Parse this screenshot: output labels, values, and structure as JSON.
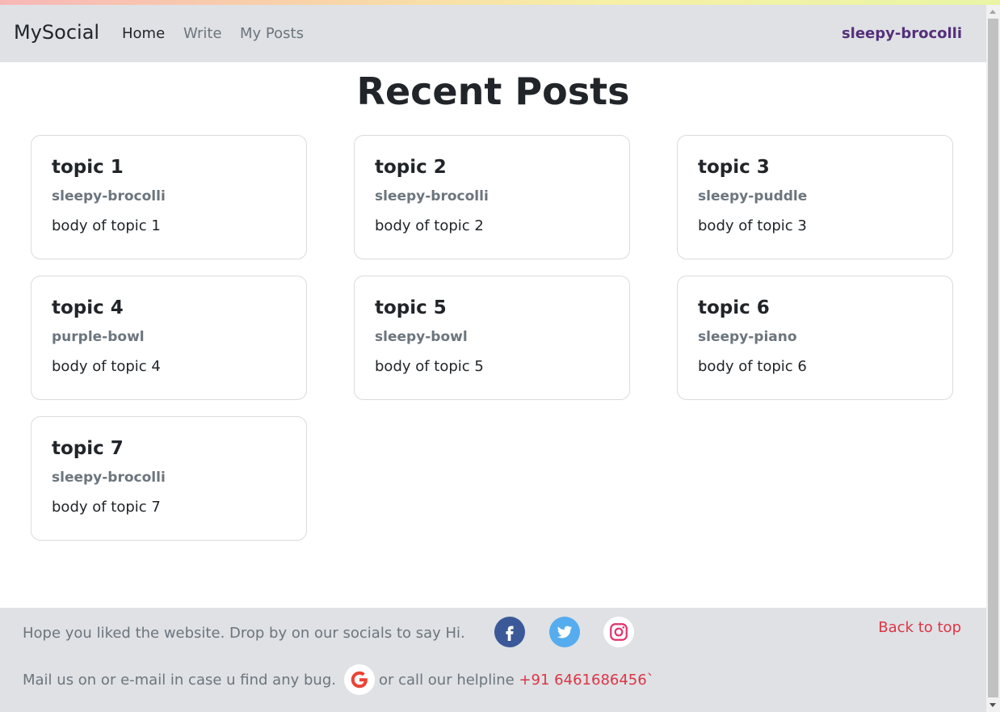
{
  "navbar": {
    "brand": "MySocial",
    "links": [
      "Home",
      "Write",
      "My Posts"
    ],
    "user": "sleepy-brocolli"
  },
  "page": {
    "title": "Recent Posts"
  },
  "posts": [
    {
      "title": "topic 1",
      "author": "sleepy-brocolli",
      "body": "body of topic 1"
    },
    {
      "title": "topic 2",
      "author": "sleepy-brocolli",
      "body": "body of topic 2"
    },
    {
      "title": "topic 3",
      "author": "sleepy-puddle",
      "body": "body of topic 3"
    },
    {
      "title": "topic 4",
      "author": "purple-bowl",
      "body": "body of topic 4"
    },
    {
      "title": "topic 5",
      "author": "sleepy-bowl",
      "body": "body of topic 5"
    },
    {
      "title": "topic 6",
      "author": "sleepy-piano",
      "body": "body of topic 6"
    },
    {
      "title": "topic 7",
      "author": "sleepy-brocolli",
      "body": "body of topic 7"
    }
  ],
  "footer": {
    "line1": "Hope you liked the website. Drop by on our socials to say Hi.",
    "line2_pre": "Mail us on or e-mail in case u find any bug.",
    "line2_post": "or call our helpline",
    "phone": "+91 6461686456`",
    "back_to_top": "Back to top",
    "icons": [
      "facebook-icon",
      "twitter-icon",
      "instagram-icon",
      "google-icon"
    ]
  },
  "colors": {
    "navbar_bg": "#dfe1e5",
    "user_link": "#55307a",
    "accent_red": "#dc3545",
    "facebook": "#3b5998",
    "twitter": "#55acee"
  }
}
